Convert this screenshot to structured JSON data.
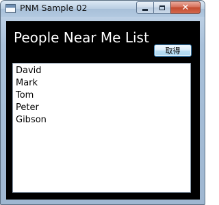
{
  "window": {
    "title": "PNM Sample 02",
    "app_icon": "window-app-icon",
    "controls": {
      "minimize_icon": "minimize-icon",
      "maximize_icon": "maximize-icon",
      "close_label": "✕"
    }
  },
  "main": {
    "title": "People Near Me List",
    "fetch_button_label": "取得",
    "people": [
      "David",
      "Mark",
      "Tom",
      "Peter",
      "Gibson"
    ]
  },
  "colors": {
    "client_background": "#000000",
    "title_text": "#ffffff",
    "list_background": "#ffffff",
    "close_button": "#c24a2e"
  }
}
